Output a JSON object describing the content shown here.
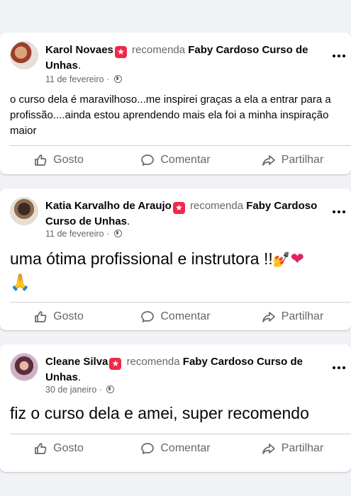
{
  "actions": {
    "like": "Gosto",
    "comment": "Comentar",
    "share": "Partilhar"
  },
  "posts": [
    {
      "author": "Karol Novaes",
      "recommends": "recomenda",
      "page": "Faby Cardoso Curso de Unhas",
      "date": "11 de fevereiro",
      "text": "o curso dela é maravilhoso...me  inspirei graças a ela a entrar para a profissão....ainda estou aprendendo mais ela foi a minha inspiração maior"
    },
    {
      "author": "Katia Karvalho de Araujo",
      "recommends": "recomenda",
      "page": "Faby Cardoso Curso de Unhas",
      "date": "11 de fevereiro",
      "text": "uma ótima profissional e instrutora !!",
      "emojis": [
        "💅",
        "❤",
        "🙏"
      ]
    },
    {
      "author": "Cleane Silva",
      "recommends": "recomenda",
      "page": "Faby Cardoso Curso de Unhas",
      "date": "30 de janeiro",
      "text": "fiz o curso dela e amei, super recomendo"
    }
  ],
  "icons": {
    "star": "star-badge-icon",
    "globe": "globe-icon",
    "like": "thumbs-up-icon",
    "comment": "speech-bubble-icon",
    "share": "share-arrow-icon",
    "more": "more-dots-icon"
  },
  "colors": {
    "badge": "#f02849",
    "muted": "#65676b",
    "text": "#050505",
    "background": "#f0f2f5"
  }
}
